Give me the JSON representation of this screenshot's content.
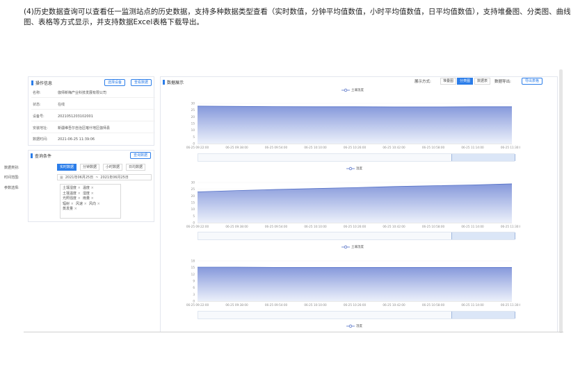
{
  "description_text": "(4)历史数据查询可以查看任一监测站点的历史数据，支持多种数据类型查看（实时数值，分钟平均值数值，小时平均值数值，日平均值数值），支持堆叠图、分类图、曲线图、表格等方式显示，并支持数据Excel表格下载导出。",
  "op_panel": {
    "title": "操作信息",
    "btn_select_device": "选择设备",
    "btn_view_data": "查看数据",
    "fields": [
      {
        "k": "名称:",
        "v": "伽师新梅产业科技发展有限公司"
      },
      {
        "k": "状态:",
        "v": "在线"
      },
      {
        "k": "设备号:",
        "v": "2021051203102001"
      },
      {
        "k": "安装地址:",
        "v": "新疆维吾尔自治区喀什地区伽师县"
      },
      {
        "k": "数据时间:",
        "v": "2021-06-25 11:39:06"
      }
    ]
  },
  "query_panel": {
    "title": "查询条件",
    "btn_query": "查询数据",
    "type_label": "数据类别:",
    "types": [
      "实时数据",
      "分钟数据",
      "小时数据",
      "日均数据"
    ],
    "active_type": 0,
    "range_label": "时间范围:",
    "date_from": "2021年06月25日",
    "date_sep": "~",
    "date_to": "2021年06月25日",
    "param_label": "参数选择:",
    "param_rows": [
      [
        "土壤湿度",
        "温度"
      ],
      [
        "土壤温度",
        "湿度"
      ],
      [
        "光照强度",
        "雨量"
      ],
      [
        "辐射",
        "风速",
        "风向"
      ],
      [
        "蒸发量"
      ]
    ],
    "remove_mark": "×"
  },
  "display_panel": {
    "title": "数据展示",
    "mode_label": "展示方式:",
    "modes": [
      "堆叠图",
      "分类图",
      "数据表"
    ],
    "active_mode": 1,
    "export_label": "数据导出:",
    "export_btn": "导出表格"
  },
  "colors": {
    "accent": "#2b7de9",
    "series_line": "#5470c6",
    "area_top": "#7f93d9",
    "area_bottom": "#e9eefa"
  },
  "chart_data": [
    {
      "type": "area",
      "legend": "土壤温度",
      "x": [
        "06-25 09:22:00",
        "06-25 09:38:00",
        "06-25 09:54:00",
        "06-25 10:10:00",
        "06-25 10:26:00",
        "06-25 10:42:00",
        "06-25 10:58:00",
        "06-25 11:14:00",
        "06-25 11:30:00"
      ],
      "yticks": [
        0,
        5,
        10,
        15,
        20,
        25,
        30
      ],
      "ylim": [
        0,
        30
      ],
      "values": [
        28,
        27.8,
        27.6,
        27.5,
        27.5,
        27.4,
        27.4,
        27.5,
        27.5
      ]
    },
    {
      "type": "area",
      "legend": "温度",
      "x": [
        "06-25 09:22:00",
        "06-25 09:38:00",
        "06-25 09:54:00",
        "06-25 10:10:00",
        "06-25 10:26:00",
        "06-25 10:42:00",
        "06-25 10:58:00",
        "06-25 11:14:00",
        "06-25 11:30:00"
      ],
      "yticks": [
        0,
        5,
        10,
        15,
        20,
        25,
        30
      ],
      "ylim": [
        0,
        30
      ],
      "values": [
        23,
        24,
        24.8,
        25.5,
        26.2,
        27,
        27.6,
        28.2,
        29
      ]
    },
    {
      "type": "area",
      "legend": "土壤湿度",
      "x": [
        "06-25 09:22:00",
        "06-25 09:38:00",
        "06-25 09:54:00",
        "06-25 10:10:00",
        "06-25 10:26:00",
        "06-25 10:42:00",
        "06-25 10:58:00",
        "06-25 11:14:00",
        "06-25 11:30:00"
      ],
      "yticks": [
        0,
        3,
        6,
        9,
        12,
        15,
        18
      ],
      "ylim": [
        0,
        18
      ],
      "values": [
        15.2,
        15.2,
        15.1,
        15.1,
        15.1,
        15.1,
        15.1,
        15.1,
        15.1
      ]
    },
    {
      "type": "area",
      "legend": "湿度"
    }
  ]
}
